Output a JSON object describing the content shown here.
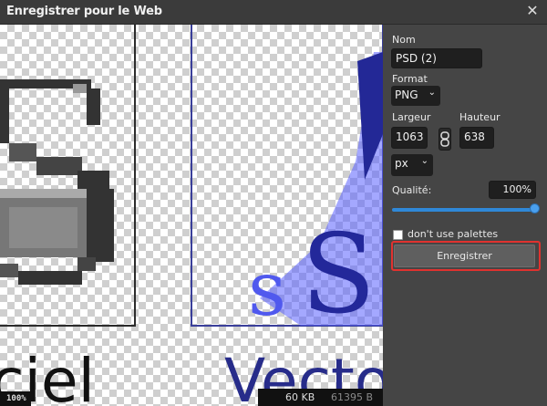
{
  "window": {
    "title": "Enregistrer pour le Web",
    "close_glyph": "✕"
  },
  "panel": {
    "name_label": "Nom",
    "name_value": "PSD (2)",
    "format_label": "Format",
    "format_value": "PNG",
    "width_label": "Largeur",
    "height_label": "Hauteur",
    "width_value": "1063",
    "height_value": "638",
    "unit_value": "px",
    "quality_label": "Qualité:",
    "quality_value": "100%",
    "palette_label": "don't use palettes",
    "save_label": "Enregistrer",
    "caret": "⌄"
  },
  "status": {
    "file_size": "60 KB",
    "bytes": "61395 B",
    "zoom": "100%"
  },
  "canvas_text": {
    "left_word": "iciel",
    "right_word": "Vecto",
    "s_big": "S",
    "s_small": "s"
  },
  "colors": {
    "accent": "#2f88d8",
    "highlight": "#e0322f",
    "panel": "#454545",
    "navy": "#1a1f8a",
    "blue": "#3b42e0"
  }
}
